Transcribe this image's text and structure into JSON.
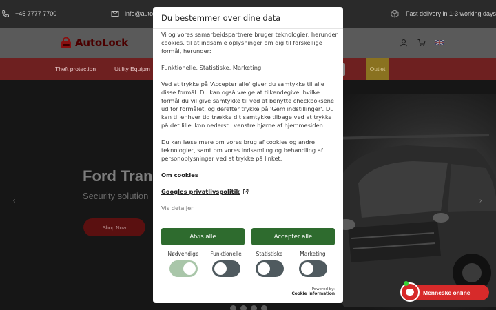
{
  "topbar": {
    "phone": "+45 7777 7700",
    "email": "info@autolock",
    "delivery": "Fast delivery in 1-3 working days"
  },
  "header": {
    "logo_prefix": "Auto",
    "logo_suffix": "Lock"
  },
  "nav": {
    "items": [
      "Theft protection",
      "Utility Equipm"
    ],
    "outlet": "Outlet"
  },
  "hero": {
    "title": "Ford Tran",
    "subtitle": "Security solution",
    "button": "Shop Now",
    "prev_arrow": "‹",
    "next_arrow": "›"
  },
  "dialog": {
    "title": "Du bestemmer over dine data",
    "p1": "Vi og vores samarbejdspartnere bruger teknologier, herunder cookies, til at indsamle oplysninger om dig til forskellige formål, herunder:",
    "purposes": "Funktionelle, Statistiske, Marketing",
    "p2": "Ved at trykke på 'Accepter alle' giver du samtykke til alle disse formål. Du kan også vælge at tilkendegive, hvilke formål du vil give samtykke til ved at benytte checkboksene ud for formålet, og derefter trykke på 'Gem indstillinger'. Du kan til enhver tid trække dit samtykke tilbage ved at trykke på det lille ikon nederst i venstre hjørne af hjemmesiden.",
    "p3": "Du kan læse mere om vores brug af cookies og andre teknologier, samt om vores indsamling og behandling af personoplysninger ved at trykke på linket.",
    "link_cookies": "Om cookies",
    "link_google": "Googles privatlivspolitik",
    "details": "Vis detaljer",
    "reject": "Afvis alle",
    "accept": "Accepter alle",
    "toggles": [
      {
        "label": "Nødvendige",
        "on": true
      },
      {
        "label": "Funktionelle",
        "on": false
      },
      {
        "label": "Statistiske",
        "on": false
      },
      {
        "label": "Marketing",
        "on": false
      }
    ],
    "powered_by": "Powered by:",
    "powered_name": "Cookie Information"
  },
  "chat": {
    "label": "Menneske online"
  }
}
